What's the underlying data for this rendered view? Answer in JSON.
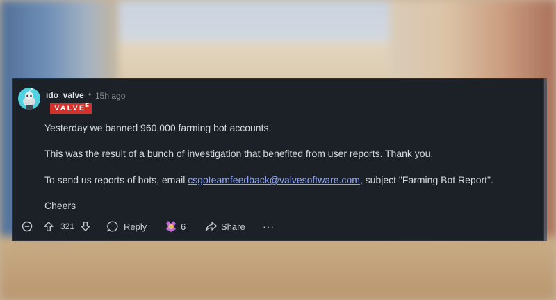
{
  "comment": {
    "username": "ido_valve",
    "separator": "•",
    "time_ago": "15h ago",
    "flair": {
      "text": "VALVE",
      "superscript": "E",
      "color": "#d4302a"
    },
    "paragraphs": [
      "Yesterday we banned 960,000 farming bot accounts.",
      "This was the result of a bunch of investigation that benefited from user reports. Thank you."
    ],
    "contact": {
      "prefix": "To send us reports of bots, email ",
      "email": "csgoteamfeedback@valvesoftware.com",
      "suffix": ", subject \"Farming Bot Report\"."
    },
    "signoff": "Cheers"
  },
  "actions": {
    "score": "321",
    "reply_label": "Reply",
    "award_count": "6",
    "share_label": "Share",
    "more_label": "···"
  },
  "icons": {
    "collapse": "minus-circle-icon",
    "upvote": "arrow-up-icon",
    "downvote": "arrow-down-icon",
    "reply": "speech-bubble-icon",
    "award": "award-icon",
    "share": "share-arrow-icon",
    "more": "ellipsis-icon"
  },
  "colors": {
    "card_bg": "#1b2127",
    "link": "#8fa6ff",
    "avatar": "#4fd1e0"
  }
}
